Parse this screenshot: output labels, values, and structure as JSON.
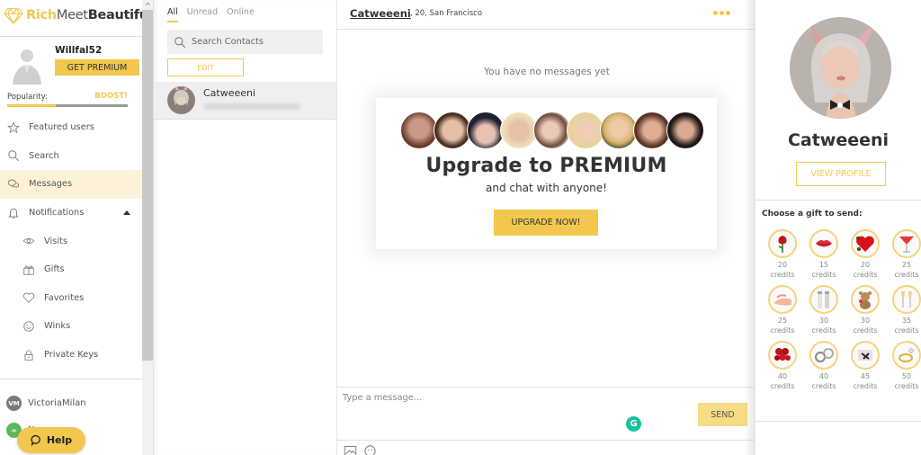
{
  "brand": {
    "part1": "Rich",
    "part2": "Meet",
    "part3": "Beautiful",
    "accent": "#f3c74e"
  },
  "me": {
    "username": "Willfal52",
    "get_premium": "GET PREMIUM",
    "popularity_label": "Popularity:",
    "boost": "BOOST!",
    "popularity_fraction": 0.4
  },
  "nav": [
    {
      "label": "Featured users",
      "icon": "star-icon"
    },
    {
      "label": "Search",
      "icon": "search-icon"
    },
    {
      "label": "Messages",
      "icon": "chat-bubbles-icon",
      "active": true
    },
    {
      "label": "Notifications",
      "icon": "bell-icon",
      "expanded": true
    },
    {
      "label": "Visits",
      "icon": "eye-icon",
      "sub": true
    },
    {
      "label": "Gifts",
      "icon": "gift-icon",
      "sub": true
    },
    {
      "label": "Favorites",
      "icon": "heart-icon",
      "sub": true
    },
    {
      "label": "Winks",
      "icon": "wink-icon",
      "sub": true
    },
    {
      "label": "Private Keys",
      "icon": "lock-icon",
      "sub": true
    }
  ],
  "partners": [
    {
      "badge": "VM",
      "label": "VictoriaMilan",
      "color": "#7a7a7a"
    },
    {
      "badge": "∞",
      "label": "Nu...",
      "color": "#5cb85c"
    }
  ],
  "help": "Help",
  "contacts": {
    "tabs": [
      "All",
      "Unread",
      "Online"
    ],
    "active_tab": "All",
    "search_placeholder": "Search Contacts",
    "edit": "EDIT",
    "items": [
      {
        "name": "Catweeeni"
      }
    ]
  },
  "chat": {
    "name": "Catweeeni",
    "meta": ", 20, San Francisco",
    "empty": "You have no messages yet",
    "promo": {
      "title": "Upgrade to PREMIUM",
      "subtitle": "and chat with anyone!",
      "button": "UPGRADE NOW!"
    },
    "input_placeholder": "Type a message...",
    "send": "SEND"
  },
  "profile": {
    "name": "Catweeeni",
    "view_profile": "VIEW PROFILE",
    "gift_title": "Choose a gift to send:",
    "credits_label": "credits",
    "gifts": [
      {
        "name": "rose",
        "credits": "20"
      },
      {
        "name": "kiss",
        "credits": "15"
      },
      {
        "name": "chocolates",
        "credits": "20"
      },
      {
        "name": "cocktail",
        "credits": "25"
      },
      {
        "name": "massage",
        "credits": "25"
      },
      {
        "name": "champagne-bottles",
        "credits": "30"
      },
      {
        "name": "teddy-bear",
        "credits": "30"
      },
      {
        "name": "champagne-toast",
        "credits": "35"
      },
      {
        "name": "roses-bouquet",
        "credits": "40"
      },
      {
        "name": "handcuffs",
        "credits": "40"
      },
      {
        "name": "lingerie",
        "credits": "45"
      },
      {
        "name": "ring",
        "credits": "50"
      }
    ]
  }
}
